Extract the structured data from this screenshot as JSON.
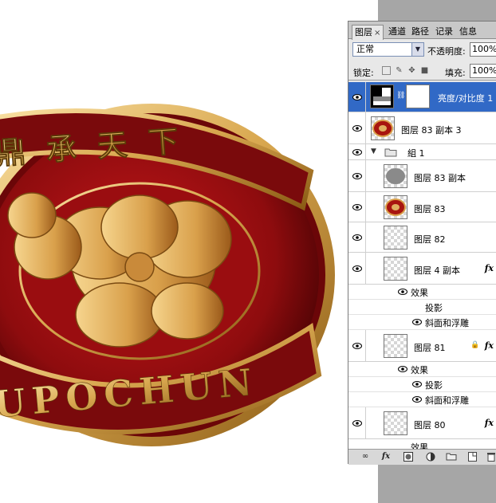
{
  "badge": {
    "top_text": "鼎承天下",
    "bottom_text": "UPOCHUN",
    "colors": {
      "red": "#8f0d0f",
      "gold": "#e9c27a",
      "dark_gold": "#9a6a1e"
    }
  },
  "panel": {
    "tabs": [
      {
        "label": "图层",
        "active": true
      },
      {
        "label": "通道",
        "active": false
      },
      {
        "label": "路径",
        "active": false
      },
      {
        "label": "记录",
        "active": false
      },
      {
        "label": "信息",
        "active": false
      }
    ],
    "blend_mode": "正常",
    "opacity_label": "不透明度:",
    "opacity_value": "100%",
    "lock_label": "锁定:",
    "fill_label": "填充:",
    "fill_value": "100%",
    "layers": [
      {
        "name": "亮度/对比度 1",
        "type": "adjustment",
        "selected": true
      },
      {
        "name": "图层 83 副本 3",
        "type": "image"
      },
      {
        "name": "組 1",
        "type": "group"
      },
      {
        "name": "图层 83 副本",
        "type": "shape"
      },
      {
        "name": "图层 83",
        "type": "image"
      },
      {
        "name": "图层 82",
        "type": "empty"
      },
      {
        "name": "图层 4 副本",
        "type": "empty",
        "fx": "fx"
      },
      {
        "name": "图层 81",
        "type": "empty",
        "fx": "fx"
      },
      {
        "name": "图层 80",
        "type": "empty",
        "fx": "fx"
      }
    ],
    "effects": {
      "label": "效果",
      "drop_shadow": "投影",
      "bevel": "斜面和浮雕"
    },
    "bottom_icons": [
      "link-icon",
      "fx-icon",
      "mask-icon",
      "adjustment-icon",
      "folder-icon",
      "new-layer-icon",
      "trash-icon"
    ],
    "accent": "#3169c6"
  }
}
